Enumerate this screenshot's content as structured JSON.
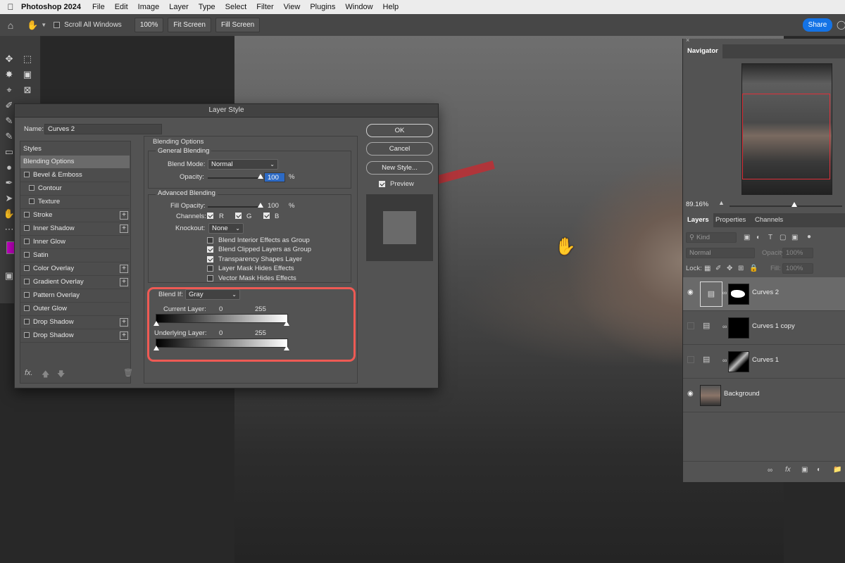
{
  "menubar": {
    "apple_icon": "apple-logo-icon",
    "app": "Photoshop 2024",
    "items": [
      "File",
      "Edit",
      "Image",
      "Layer",
      "Type",
      "Select",
      "Filter",
      "View",
      "Plugins",
      "Window",
      "Help"
    ]
  },
  "optionsbar": {
    "scroll_all_label": "Scroll All Windows",
    "zoom_btn": "100%",
    "fit_btn": "Fit Screen",
    "fill_btn": "Fill Screen",
    "share": "Share"
  },
  "dialog": {
    "title": "Layer Style",
    "name_label": "Name:",
    "name_value": "Curves 2",
    "styles_header": "Styles",
    "styles": [
      {
        "label": "Blending Options",
        "check": false,
        "plus": false,
        "selected": true
      },
      {
        "label": "Bevel & Emboss",
        "check": true,
        "plus": false
      },
      {
        "label": "Contour",
        "check": true,
        "plus": false,
        "indent": true
      },
      {
        "label": "Texture",
        "check": true,
        "plus": false,
        "indent": true
      },
      {
        "label": "Stroke",
        "check": true,
        "plus": true
      },
      {
        "label": "Inner Shadow",
        "check": true,
        "plus": true
      },
      {
        "label": "Inner Glow",
        "check": true,
        "plus": false
      },
      {
        "label": "Satin",
        "check": true,
        "plus": false
      },
      {
        "label": "Color Overlay",
        "check": true,
        "plus": true
      },
      {
        "label": "Gradient Overlay",
        "check": true,
        "plus": true
      },
      {
        "label": "Pattern Overlay",
        "check": true,
        "plus": false
      },
      {
        "label": "Outer Glow",
        "check": true,
        "plus": false
      },
      {
        "label": "Drop Shadow",
        "check": true,
        "plus": true
      },
      {
        "label": "Drop Shadow",
        "check": true,
        "plus": true
      }
    ],
    "fx_label": "fx.",
    "blending_options": "Blending Options",
    "general_blending": "General Blending",
    "blend_mode_label": "Blend Mode:",
    "blend_mode_value": "Normal",
    "opacity_label": "Opacity:",
    "opacity_value": "100",
    "percent": "%",
    "advanced_blending": "Advanced Blending",
    "fill_opacity_label": "Fill Opacity:",
    "fill_opacity_value": "100",
    "channels_label": "Channels:",
    "channel_r": "R",
    "channel_g": "G",
    "channel_b": "B",
    "knockout_label": "Knockout:",
    "knockout_value": "None",
    "options": [
      {
        "label": "Blend Interior Effects as Group",
        "checked": false
      },
      {
        "label": "Blend Clipped Layers as Group",
        "checked": true
      },
      {
        "label": "Transparency Shapes Layer",
        "checked": true
      },
      {
        "label": "Layer Mask Hides Effects",
        "checked": false
      },
      {
        "label": "Vector Mask Hides Effects",
        "checked": false
      }
    ],
    "blend_if_label": "Blend If:",
    "blend_if_value": "Gray",
    "current_layer_label": "Current Layer:",
    "current_low": "0",
    "current_high": "255",
    "underlying_layer_label": "Underlying Layer:",
    "underlying_low": "0",
    "underlying_high": "255",
    "ok": "OK",
    "cancel": "Cancel",
    "new_style": "New Style...",
    "preview_label": "Preview"
  },
  "navigator": {
    "tab": "Navigator",
    "zoom": "89.16%"
  },
  "layers_panel": {
    "tabs": [
      "Layers",
      "Properties",
      "Channels"
    ],
    "kind": "Kind",
    "mode": "Normal",
    "opacity_label": "Opacity:",
    "opacity_value": "100%",
    "lock_label": "Lock:",
    "fill_label": "Fill:",
    "fill_value": "100%",
    "layers": [
      {
        "name": "Curves 2",
        "visible": true,
        "selected": true
      },
      {
        "name": "Curves 1 copy",
        "visible": false,
        "selected": false
      },
      {
        "name": "Curves 1",
        "visible": false,
        "selected": false
      },
      {
        "name": "Background",
        "visible": true,
        "selected": false
      }
    ]
  },
  "colors": {
    "highlight_box": "#ee5a54",
    "share_button": "#1473e6",
    "navigator_frame": "#e0303a"
  }
}
